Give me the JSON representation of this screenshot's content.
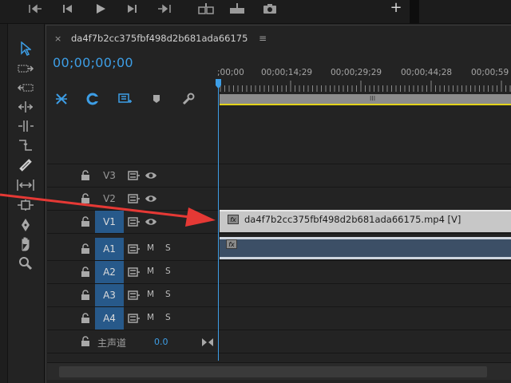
{
  "window": {
    "sequence_tab_title": "da4f7b2cc375fbf498d2b681ada66175",
    "tab_close": "×",
    "tab_menu": "≡",
    "add_button": "+"
  },
  "transport": {
    "icons": [
      "go-to-in-icon",
      "step-back-icon",
      "play-icon",
      "step-forward-icon",
      "go-to-out-icon",
      "insert-icon",
      "overwrite-icon",
      "export-frame-icon"
    ]
  },
  "tools": [
    "selection-tool-icon",
    "track-select-forward-icon",
    "track-select-backward-icon",
    "ripple-edit-icon",
    "rolling-edit-icon",
    "rate-stretch-icon",
    "razor-icon",
    "slip-icon",
    "slide-icon",
    "pen-icon",
    "hand-icon",
    "zoom-icon"
  ],
  "timeline": {
    "timecode": "00;00;00;00",
    "ruler": [
      ";00;00",
      "00;00;14;29",
      "00;00;29;29",
      "00;00;44;28",
      "00;00;59"
    ],
    "work_area_grip": "III",
    "header_icons": [
      "snap-icon",
      "linked-selection-icon",
      "add-marker-icon",
      "marker-icon",
      "settings-wrench-icon"
    ],
    "tracks": [
      {
        "name": "V3",
        "type": "video",
        "active": false
      },
      {
        "name": "V2",
        "type": "video",
        "active": false
      },
      {
        "name": "V1",
        "type": "video",
        "active": true
      },
      {
        "name": "A1",
        "type": "audio",
        "active": true,
        "mute": "M",
        "solo": "S"
      },
      {
        "name": "A2",
        "type": "audio",
        "active": true,
        "mute": "M",
        "solo": "S"
      },
      {
        "name": "A3",
        "type": "audio",
        "active": true,
        "mute": "M",
        "solo": "S"
      },
      {
        "name": "A4",
        "type": "audio",
        "active": true,
        "mute": "M",
        "solo": "S"
      }
    ],
    "master": {
      "label": "主声道",
      "volume": "0.0"
    },
    "clips": {
      "video": {
        "label": "da4f7b2cc375fbf498d2b681ada66175.mp4 [V]",
        "fx": "fx"
      },
      "audio": {
        "fx": "fx"
      }
    }
  },
  "colors": {
    "accent": "#3d9ee6",
    "active_track": "#27598a",
    "annotation_arrow": "#e53935",
    "work_area_line": "#e3d21a"
  }
}
